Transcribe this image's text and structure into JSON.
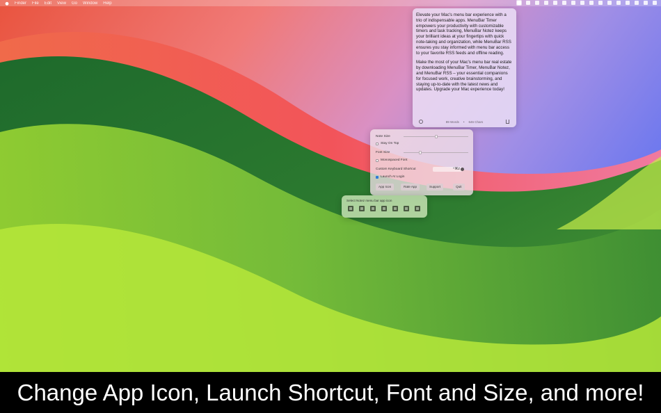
{
  "menubar": {
    "items": [
      "Finder",
      "File",
      "Edit",
      "View",
      "Go",
      "Window",
      "Help"
    ]
  },
  "note": {
    "paragraph1": "Elevate your Mac's menu bar experience with a trio of indispensable apps. MenuBar Timer empowers your productivity with customizable timers and task tracking, MenuBar Notez keeps your brilliant ideas at your fingertips with quick note-taking and organization, while MenuBar RSS ensures you stay informed with menu bar access to your favorite RSS feeds and offline reading.",
    "paragraph2": "Make the most of your Mac's menu bar real estate by downloading MenuBar Timer, MenuBar Notez, and MenuBar RSS – your essential companions for focused work, creative brainstorming, and staying up-to-date with the latest news and updates. Upgrade your Mac experience today!",
    "word_count": "89 Words",
    "separator": "•",
    "char_count": "646 Chars"
  },
  "settings": {
    "note_size_label": "Note Size",
    "note_size_value": 0.5,
    "stay_on_top_label": "Stay On Top",
    "stay_on_top_checked": false,
    "font_size_label": "Font Size",
    "font_size_value": 0.25,
    "monospaced_label": "Monospaced Font",
    "monospaced_checked": false,
    "shortcut_label": "Custom Keyboard Shortcut",
    "shortcut_value": "^⌘Z",
    "launch_login_label": "Launch At Login",
    "launch_login_checked": true,
    "buttons": {
      "app_icon": "App Icon",
      "rate_app": "Rate App",
      "support": "Support",
      "quit": "Quit"
    }
  },
  "icon_picker": {
    "title": "Select Notez menu bar app icon",
    "icons": [
      "notebook-icon",
      "book-icon",
      "binder-icon",
      "calendar-icon",
      "clipboard-icon",
      "compose-icon",
      "document-icon"
    ]
  },
  "caption": "Change App Icon, Launch Shortcut, Font and Size, and more!"
}
